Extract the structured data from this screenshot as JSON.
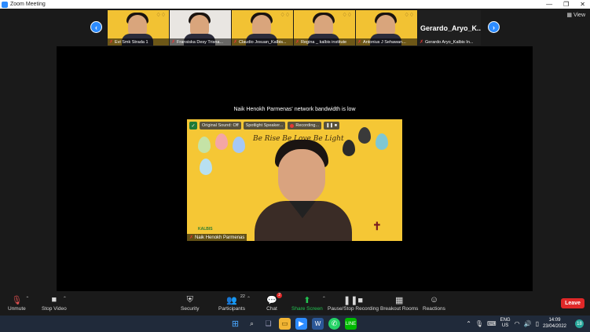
{
  "window": {
    "title": "Zoom Meeting",
    "minimize_glyph": "—",
    "maximize_glyph": "❐",
    "close_glyph": "✕"
  },
  "view_button": {
    "label": "View"
  },
  "gallery": {
    "tiles": [
      {
        "name": "Evi Smk Strada 1"
      },
      {
        "name": "Fransiska Desy Trisna..."
      },
      {
        "name": "Claudio Josuan_Kalbis..."
      },
      {
        "name": "Regina _ kalbis institute"
      },
      {
        "name": "Antonius J Sehawan..."
      },
      {
        "name": "Gerardo Aryo_Kalbis In...",
        "display_name": "Gerardo_Aryo_K..."
      }
    ]
  },
  "main_video": {
    "bandwidth_notice": "Naik Henokh Parmenas' network bandwidth is low",
    "speaker_name": "Naik Henokh Parmenas",
    "banner_text": "Be Rise Be Love Be Light",
    "logo_text": "KALBIS",
    "toolbar": {
      "original_sound": "Original Sound: Off",
      "spotlight": "Spotlight Speaker...",
      "recording": "Recording..."
    }
  },
  "meeting_toolbar": {
    "unmute": "Unmute",
    "stop_video": "Stop Video",
    "security": "Security",
    "participants": "Participants",
    "participants_count": "22",
    "chat": "Chat",
    "chat_badge": "2",
    "share_screen": "Share Screen",
    "pause_stop_recording": "Pause/Stop Recording",
    "breakout_rooms": "Breakout Rooms",
    "reactions": "Reactions",
    "leave": "Leave"
  },
  "taskbar": {
    "lang_line1": "ENG",
    "lang_line2": "US",
    "time": "14:09",
    "date": "23/04/2022",
    "notification_count": "18"
  },
  "colors": {
    "zoom_blue": "#2d8cff",
    "leave_red": "#e02828",
    "share_green": "#23c552",
    "tile_yellow": "#f2c233"
  }
}
